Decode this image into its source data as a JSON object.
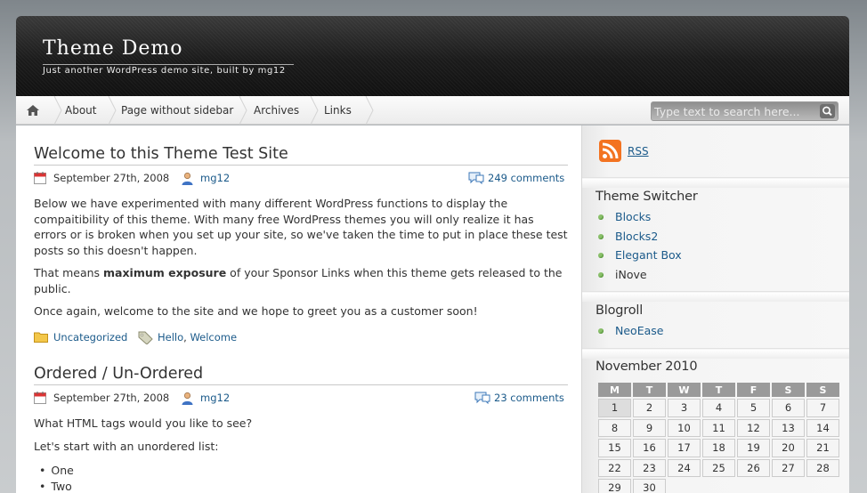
{
  "header": {
    "title": "Theme Demo",
    "description": "Just another WordPress demo site, built by mg12"
  },
  "nav": {
    "home_icon": "home-icon",
    "items": [
      {
        "label": "About"
      },
      {
        "label": "Page without sidebar"
      },
      {
        "label": "Archives"
      },
      {
        "label": "Links"
      }
    ],
    "search_placeholder": "Type text to search here...",
    "search_icon": "magnifier-icon"
  },
  "posts": [
    {
      "title": "Welcome to this Theme Test Site",
      "date": "September 27th, 2008",
      "author": "mg12",
      "comments": "249 comments",
      "paragraphs": [
        "Below we have experimented with many different WordPress functions to display the compaitibility of this theme. With many free WordPress themes you will only realize it has errors or is broken when you set up your site, so we've taken the time to put in place these test posts so this doesn't happen.",
        "Once again, welcome to the site and we hope to greet you as a customer soon!"
      ],
      "paragraph2": {
        "before": "That means ",
        "bold": "maximum exposure",
        "after": " of your Sponsor Links when this theme gets released to the public."
      },
      "category": "Uncategorized",
      "tags": [
        "Hello",
        "Welcome"
      ],
      "tag_separator": ","
    },
    {
      "title": "Ordered / Un-Ordered",
      "date": "September 27th, 2008",
      "author": "mg12",
      "comments": "23 comments",
      "paragraphs": [
        "What HTML tags would you like to see?",
        "Let's start with an unordered list:"
      ],
      "list": [
        "One",
        "Two"
      ]
    }
  ],
  "sidebar": {
    "rss_label": "RSS",
    "rss_color": "#f37321",
    "theme_switcher": {
      "title": "Theme Switcher",
      "items": [
        {
          "label": "Blocks",
          "link": true
        },
        {
          "label": "Blocks2",
          "link": true
        },
        {
          "label": "Elegant Box",
          "link": true
        },
        {
          "label": "iNove",
          "link": false
        }
      ]
    },
    "blogroll": {
      "title": "Blogroll",
      "items": [
        "NeoEase"
      ]
    },
    "calendar": {
      "title": "November 2010",
      "headers": [
        "M",
        "T",
        "W",
        "T",
        "F",
        "S",
        "S"
      ],
      "weeks": [
        [
          "1",
          "2",
          "3",
          "4",
          "5",
          "6",
          "7"
        ],
        [
          "8",
          "9",
          "10",
          "11",
          "12",
          "13",
          "14"
        ],
        [
          "15",
          "16",
          "17",
          "18",
          "19",
          "20",
          "21"
        ],
        [
          "22",
          "23",
          "24",
          "25",
          "26",
          "27",
          "28"
        ],
        [
          "29",
          "30",
          "",
          "",
          "",
          "",
          ""
        ]
      ],
      "today": "1"
    }
  },
  "colors": {
    "link": "#1b5a8a",
    "bullet": "#8ac06a",
    "header_bg": "#1b1b1b"
  }
}
